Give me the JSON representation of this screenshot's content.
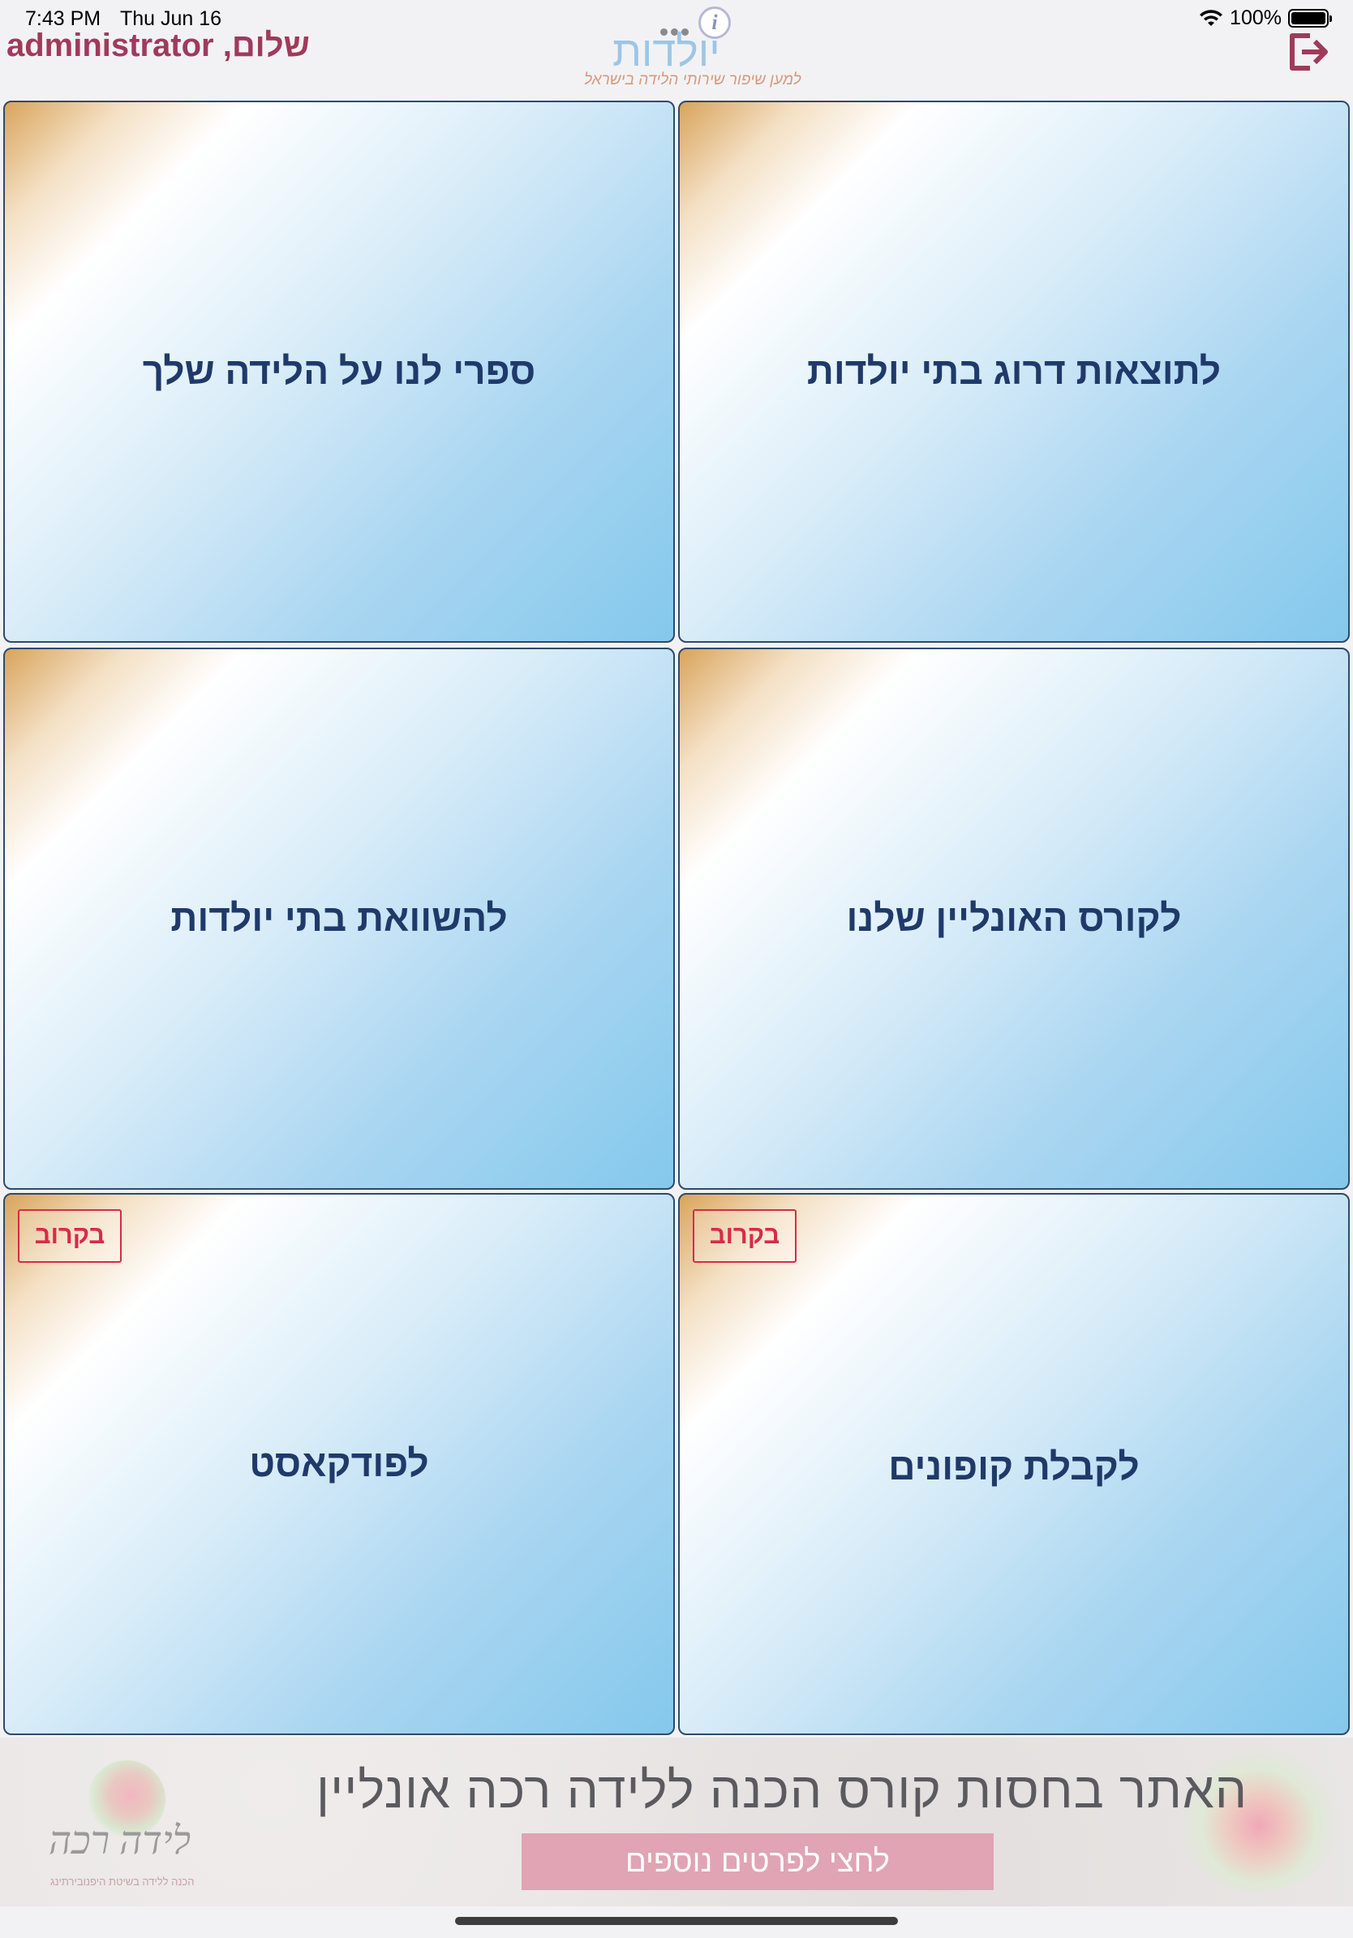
{
  "status_bar": {
    "time": "7:43 PM",
    "date": "Thu Jun 16",
    "battery": "100%"
  },
  "header": {
    "greeting": "שלום, administrator",
    "logo_title": "יולדות",
    "logo_tagline": "למען שיפור שירותי הלידה בישראל",
    "logo_info_glyph": "i",
    "logout_icon": "logout-icon"
  },
  "tiles": [
    {
      "label": "ספרי לנו על הלידה שלך",
      "badge": ""
    },
    {
      "label": "לתוצאות דרוג בתי יולדות",
      "badge": ""
    },
    {
      "label": "להשוואת בתי יולדות",
      "badge": ""
    },
    {
      "label": "לקורס האונליין שלנו",
      "badge": ""
    },
    {
      "label": "לפודקאסט",
      "badge": "בקרוב"
    },
    {
      "label": "לקבלת קופונים",
      "badge": "בקרוב"
    }
  ],
  "banner": {
    "headline": "האתר בחסות קורס הכנה ללידה רכה אונליין",
    "cta": "לחצי לפרטים נוספים",
    "logo_script": "לידה רכה",
    "logo_sub": "הכנה ללידה בשיטת היפנובירתינג"
  },
  "colors": {
    "greeting": "#a03a5a",
    "tile_text": "#1f3a6a",
    "badge": "#d82a4a",
    "tile_border": "#2f4a6a",
    "cta_bg": "#e0a4b4"
  }
}
